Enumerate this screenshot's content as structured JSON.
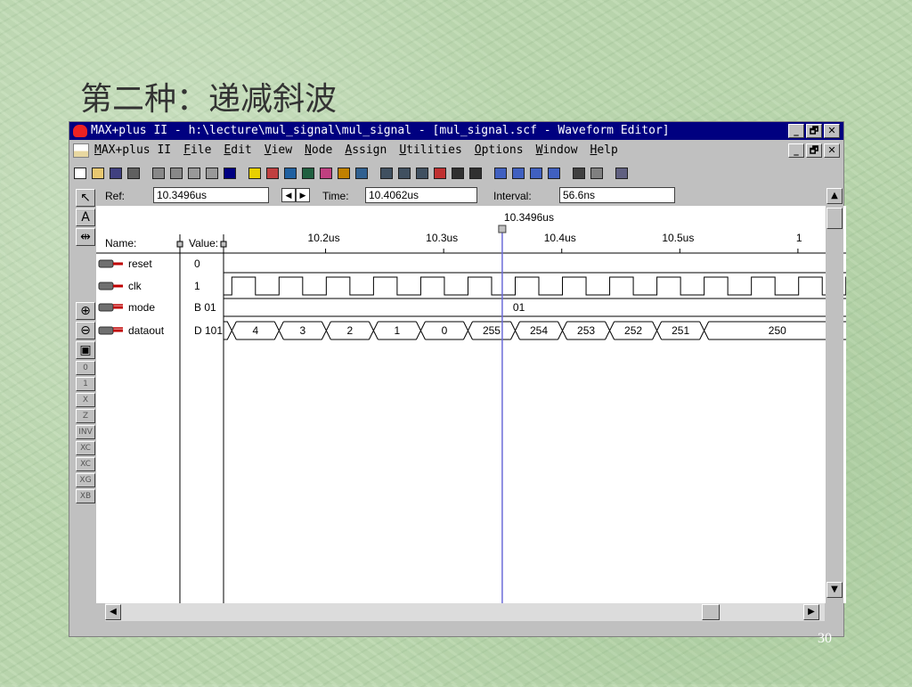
{
  "slide": {
    "title": "第二种：递减斜波",
    "page_number": "30"
  },
  "window": {
    "title": "MAX+plus II - h:\\lecture\\mul_signal\\mul_signal - [mul_signal.scf - Waveform Editor]",
    "controls": [
      "_",
      "🗗",
      "✕"
    ]
  },
  "menubar": {
    "items": [
      {
        "u": "M",
        "rest": "AX+plus II"
      },
      {
        "u": "F",
        "rest": "ile"
      },
      {
        "u": "E",
        "rest": "dit"
      },
      {
        "u": "V",
        "rest": "iew"
      },
      {
        "u": "N",
        "rest": "ode"
      },
      {
        "u": "A",
        "rest": "ssign"
      },
      {
        "u": "U",
        "rest": "tilities"
      },
      {
        "u": "O",
        "rest": "ptions"
      },
      {
        "u": "W",
        "rest": "indow"
      },
      {
        "u": "H",
        "rest": "elp"
      }
    ]
  },
  "toolbar": {
    "icons": [
      "new-icon",
      "open-icon",
      "save-icon",
      "print-icon",
      "cut-icon",
      "copy-icon",
      "paste-icon",
      "undo-icon",
      "help-pointer-icon",
      "warning-icon",
      "hierarchy-icon",
      "floorplan-icon",
      "compiler-icon",
      "simulator-icon",
      "timing-analyzer-icon",
      "programmer-icon",
      "project-open-icon",
      "project-save-icon",
      "project-compile-icon",
      "project-check-icon",
      "project-simulate-icon",
      "project-timing-icon",
      "find-node-icon",
      "find-node-up-icon",
      "find-node-down-icon",
      "find-node-all-icon",
      "grid-icon",
      "grid-off-icon",
      "zoom-fit-icon"
    ]
  },
  "info": {
    "ref_label": "Ref:",
    "ref_value": "10.3496us",
    "time_label": "Time:",
    "time_value": "10.4062us",
    "interval_label": "Interval:",
    "interval_value": "56.6ns",
    "cursor_label": "10.3496us"
  },
  "columns": {
    "name": "Name:",
    "value": "Value:"
  },
  "time_axis": {
    "labels": [
      "10.2us",
      "10.3us",
      "10.4us",
      "10.5us",
      "1"
    ],
    "times_us": [
      10.2,
      10.3,
      10.4,
      10.5,
      10.6
    ]
  },
  "signals": [
    {
      "name": "reset",
      "value": "0",
      "icon": "input-pin-icon",
      "kind": "low"
    },
    {
      "name": "clk",
      "value": "1",
      "icon": "input-pin-icon",
      "kind": "clock"
    },
    {
      "name": "mode",
      "value": "B 01",
      "icon": "input-bus-icon",
      "kind": "bus",
      "segments": [
        "01"
      ]
    },
    {
      "name": "dataout",
      "value": "D 101",
      "icon": "output-bus-icon",
      "kind": "bus",
      "segments": [
        "4",
        "3",
        "2",
        "1",
        "0",
        "255",
        "254",
        "253",
        "252",
        "251",
        "250"
      ]
    }
  ],
  "waveform": {
    "start_us": 10.1136,
    "end_us": 10.6408,
    "clock_period_us": 0.04,
    "clock_first_rise_us": 10.1206,
    "clock_duty": 0.5,
    "cursor_us": 10.3496,
    "dataout_edges_us": [
      10.1206,
      10.1606,
      10.2006,
      10.2406,
      10.2806,
      10.3206,
      10.3606,
      10.4006,
      10.4406,
      10.4806,
      10.5206
    ]
  },
  "left_tools": [
    {
      "name": "selection-tool-icon",
      "glyph": "↖"
    },
    {
      "name": "text-tool-icon",
      "glyph": "A"
    },
    {
      "name": "zoom-tool-icon",
      "glyph": "⇹"
    }
  ],
  "left_tools_lower": [
    {
      "name": "zoom-in-icon",
      "glyph": "⊕"
    },
    {
      "name": "zoom-out-icon",
      "glyph": "⊖"
    },
    {
      "name": "fit-window-icon",
      "glyph": "▣"
    },
    {
      "name": "set-low-icon",
      "glyph": "0"
    },
    {
      "name": "set-high-icon",
      "glyph": "1"
    },
    {
      "name": "set-dontcare-icon",
      "glyph": "X"
    },
    {
      "name": "set-highz-icon",
      "glyph": "Z"
    },
    {
      "name": "invert-icon",
      "glyph": "INV"
    },
    {
      "name": "overwrite-count-icon",
      "glyph": "XC"
    },
    {
      "name": "overwrite-clock-icon",
      "glyph": "XC"
    },
    {
      "name": "overwrite-group-icon",
      "glyph": "XG"
    },
    {
      "name": "overwrite-value-icon",
      "glyph": "XB"
    }
  ],
  "colors": {
    "titlebar": "#000080",
    "cursor_line": "#6b6bd8",
    "waveform": "#000000",
    "window_bg": "#c0c0c0"
  }
}
